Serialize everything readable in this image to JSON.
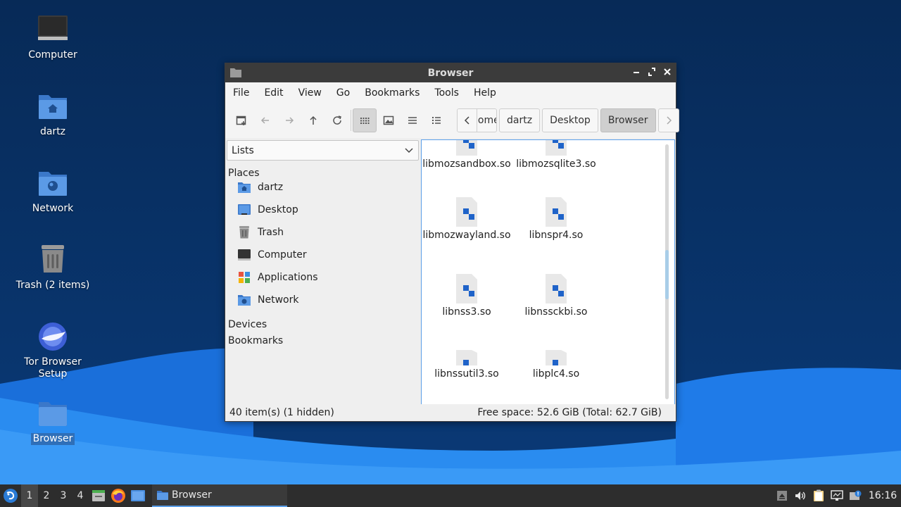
{
  "desktop": {
    "icons": [
      {
        "label": "Computer",
        "icon": "computer-icon"
      },
      {
        "label": "dartz",
        "icon": "home-folder-icon"
      },
      {
        "label": "Network",
        "icon": "network-folder-icon"
      },
      {
        "label": "Trash (2 items)",
        "icon": "trash-icon"
      },
      {
        "label": "Tor Browser Setup",
        "icon": "tor-browser-icon"
      },
      {
        "label": "Browser",
        "icon": "folder-icon",
        "selected": true
      }
    ]
  },
  "window": {
    "title": "Browser",
    "menu": [
      "File",
      "Edit",
      "View",
      "Go",
      "Bookmarks",
      "Tools",
      "Help"
    ],
    "path": [
      {
        "label": "home",
        "clipped": true
      },
      {
        "label": "dartz"
      },
      {
        "label": "Desktop"
      },
      {
        "label": "Browser",
        "current": true
      }
    ],
    "side": {
      "combo": "Lists",
      "places_heading": "Places",
      "places": [
        {
          "label": "dartz",
          "icon": "home-folder-icon"
        },
        {
          "label": "Desktop",
          "icon": "desktop-icon"
        },
        {
          "label": "Trash",
          "icon": "trash-icon"
        },
        {
          "label": "Computer",
          "icon": "computer-icon"
        },
        {
          "label": "Applications",
          "icon": "applications-icon"
        },
        {
          "label": "Network",
          "icon": "network-folder-icon"
        }
      ],
      "devices_heading": "Devices",
      "bookmarks_heading": "Bookmarks"
    },
    "files": [
      {
        "name": "libmozsandbox.so"
      },
      {
        "name": "libmozsqlite3.so"
      },
      {
        "name": "libmozwayland.so"
      },
      {
        "name": "libnspr4.so"
      },
      {
        "name": "libnss3.so"
      },
      {
        "name": "libnssckbi.so"
      },
      {
        "name": "libnssutil3.so"
      },
      {
        "name": "libplc4.so"
      }
    ],
    "status": {
      "left": "40 item(s) (1 hidden)",
      "right": "Free space: 52.6 GiB (Total: 62.7 GiB)"
    }
  },
  "taskbar": {
    "workspaces": [
      "1",
      "2",
      "3",
      "4"
    ],
    "active_workspace": "1",
    "task_label": "Browser",
    "clock": "16:16"
  },
  "colors": {
    "accent": "#5a9ee8",
    "file_icon_blue": "#1f63c9"
  }
}
